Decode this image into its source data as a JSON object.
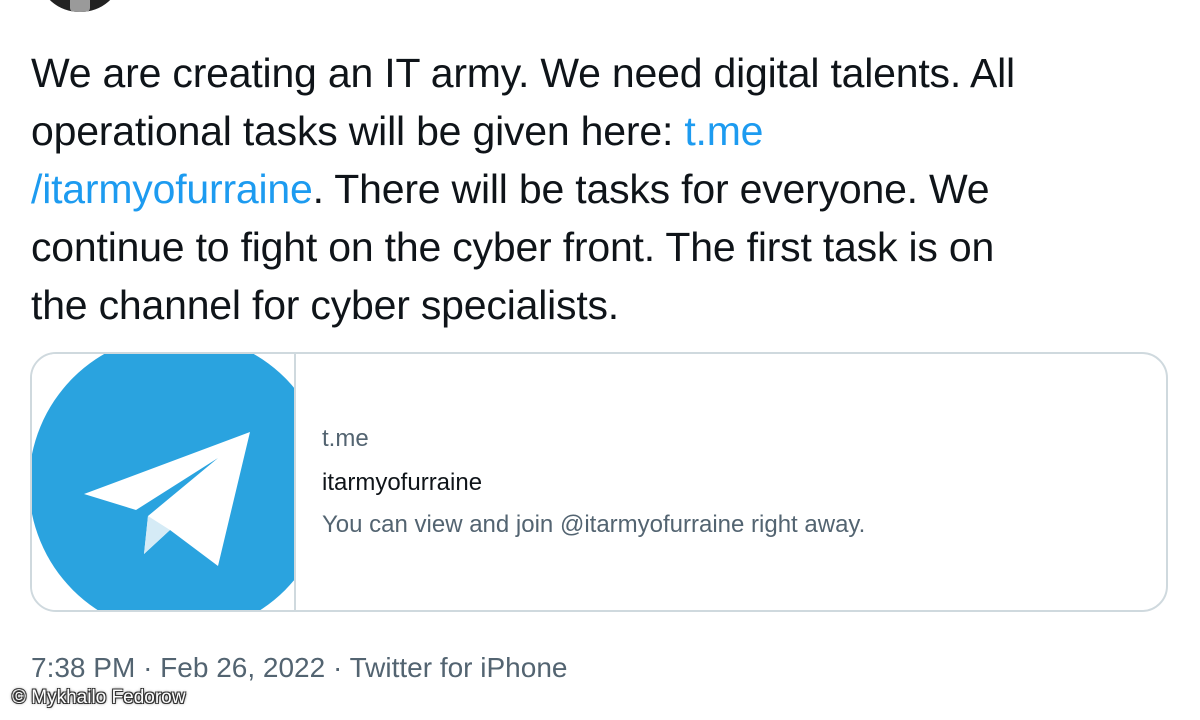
{
  "tweet": {
    "text_lines": {
      "l1": "We are creating an IT army. We need digital talents. All",
      "l2_pre": "operational tasks will be given here: ",
      "l2_link": "t.me",
      "l3_link": "/itarmyofurraine",
      "l3_post": ". There will be tasks for everyone. We",
      "l4": "continue to fight on the cyber front. The first task is on",
      "l5": "the channel for cyber specialists."
    },
    "link_color": "#1d9bf0"
  },
  "card": {
    "domain": "t.me",
    "title": "itarmyofurraine",
    "description": "You can view and join @itarmyofurraine right away.",
    "icon": "telegram-logo-icon",
    "icon_color": "#2aa3df"
  },
  "meta": {
    "time": "7:38 PM",
    "separator": "·",
    "date": "Feb 26, 2022",
    "source": "Twitter for iPhone"
  },
  "credit": {
    "text": "© Mykhailo Fedorow"
  }
}
